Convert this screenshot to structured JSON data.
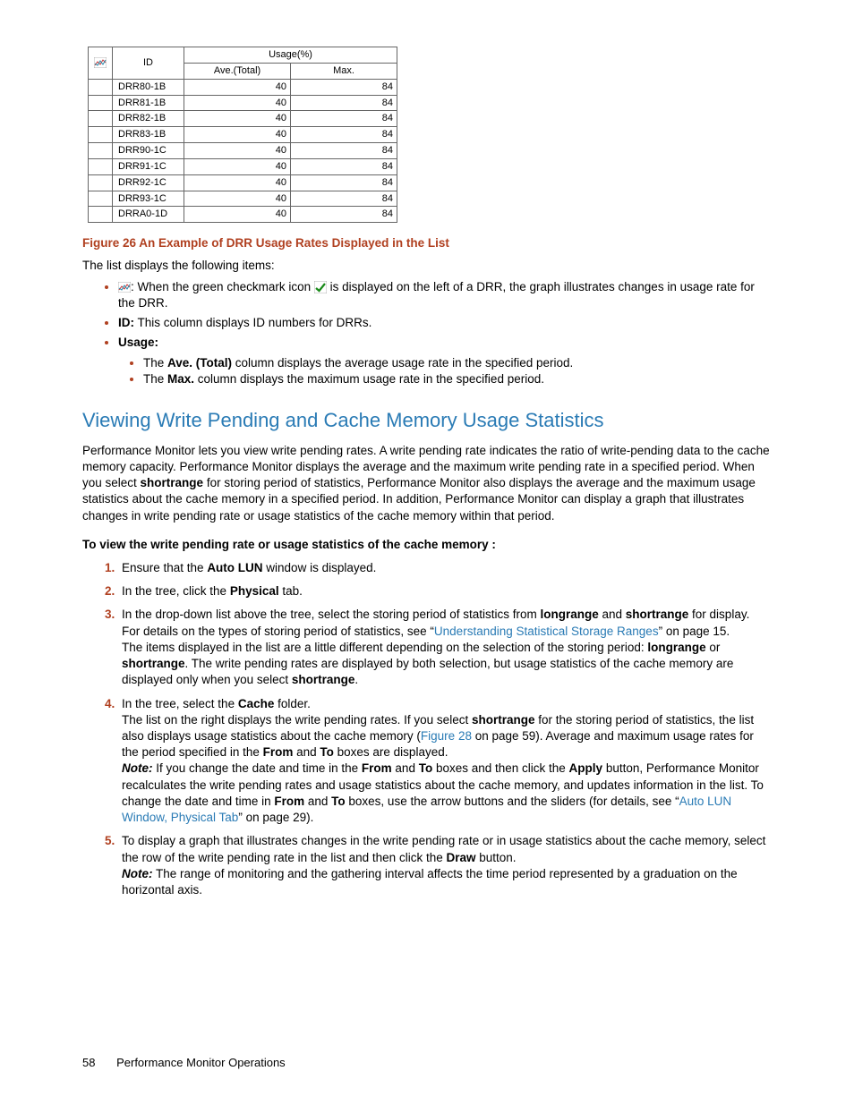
{
  "table": {
    "headers": {
      "id": "ID",
      "usage": "Usage(%)",
      "ave": "Ave.(Total)",
      "max": "Max."
    },
    "rows": [
      {
        "id": "DRR80-1B",
        "ave": "40",
        "max": "84"
      },
      {
        "id": "DRR81-1B",
        "ave": "40",
        "max": "84"
      },
      {
        "id": "DRR82-1B",
        "ave": "40",
        "max": "84"
      },
      {
        "id": "DRR83-1B",
        "ave": "40",
        "max": "84"
      },
      {
        "id": "DRR90-1C",
        "ave": "40",
        "max": "84"
      },
      {
        "id": "DRR91-1C",
        "ave": "40",
        "max": "84"
      },
      {
        "id": "DRR92-1C",
        "ave": "40",
        "max": "84"
      },
      {
        "id": "DRR93-1C",
        "ave": "40",
        "max": "84"
      },
      {
        "id": "DRRA0-1D",
        "ave": "40",
        "max": "84"
      }
    ]
  },
  "figure_caption": "Figure 26 An Example of DRR Usage Rates Displayed in the List",
  "intro_list": "The list displays the following items:",
  "bullets": {
    "b1_after": ": When the green checkmark icon ",
    "b1_end": " is displayed on the left of a DRR, the graph illustrates changes in usage rate for the DRR.",
    "b2_bold": "ID:",
    "b2_text": " This column displays ID numbers for DRRs.",
    "b3_bold": "Usage:",
    "b3_sub1_pre": "The ",
    "b3_sub1_bold": "Ave. (Total)",
    "b3_sub1_post": " column displays the average usage rate in the specified period.",
    "b3_sub2_pre": "The ",
    "b3_sub2_bold": "Max.",
    "b3_sub2_post": " column displays the maximum usage rate in the specified period."
  },
  "section_heading": "Viewing Write Pending and Cache Memory Usage Statistics",
  "section_para": "Performance Monitor lets you view write pending rates. A write pending rate indicates the ratio of write-pending data to the cache memory capacity. Performance Monitor displays the average and the maximum write pending rate in a specified period. When you select ",
  "section_para_b1": "shortrange",
  "section_para_2": " for storing period of statistics, Performance Monitor also displays the average and the maximum usage statistics about the cache memory in a specified period. In addition, Performance Monitor can display a graph that illustrates changes in write pending rate or usage statistics of the cache memory within that period.",
  "procedure_heading": "To view the write pending rate or usage statistics of the cache memory :",
  "step1_pre": "Ensure that the ",
  "step1_b": "Auto LUN",
  "step1_post": " window is displayed.",
  "step2_pre": "In the tree, click the ",
  "step2_b": "Physical",
  "step2_post": " tab.",
  "step3_pre": "In the drop-down list above the tree, select the storing period of statistics from ",
  "step3_b1": "longrange",
  "step3_mid": " and ",
  "step3_b2": "shortrange",
  "step3_post": " for display.",
  "step3_p2_pre": "For details on the types of storing period of statistics, see “",
  "step3_link": "Understanding Statistical Storage Ranges",
  "step3_p2_post": "” on page 15.",
  "step3_p3_pre": "The items displayed in the list are a little different depending on the selection of the storing period: ",
  "step3_p3_b1": "longrange",
  "step3_p3_mid": " or ",
  "step3_p3_b2": "shortrange",
  "step3_p3_post": ". The write pending rates are displayed by both selection, but usage statistics of the cache memory are displayed only when you select ",
  "step3_p3_b3": "shortrange",
  "step3_p3_end": ".",
  "step4_pre": "In the tree, select the ",
  "step4_b": "Cache",
  "step4_post": " folder.",
  "step4_p2_pre": "The list on the right displays the write pending rates. If you select ",
  "step4_p2_b1": "shortrange",
  "step4_p2_mid": " for the storing period of statistics, the list also displays usage statistics about the cache memory (",
  "step4_p2_link": "Figure 28",
  "step4_p2_post": " on page 59). Average and maximum usage rates for the period specified in the ",
  "step4_p2_b2": "From",
  "step4_p2_and": " and ",
  "step4_p2_b3": "To",
  "step4_p2_end": " boxes are displayed.",
  "step4_note": "Note:",
  "step4_p3_pre": " If you change the date and time in the ",
  "step4_p3_b1": "From",
  "step4_p3_and1": " and ",
  "step4_p3_b2": "To",
  "step4_p3_mid1": " boxes and then click the ",
  "step4_p3_b3": "Apply",
  "step4_p3_mid2": " button, Performance Monitor recalculates the write pending rates and usage statistics about the cache memory, and updates information in the list. To change the date and time in ",
  "step4_p3_b4": "From",
  "step4_p3_and2": " and ",
  "step4_p3_b5": "To",
  "step4_p3_mid3": " boxes, use the arrow buttons and the sliders (for details, see “",
  "step4_p3_link": "Auto LUN Window, Physical Tab",
  "step4_p3_post": "” on page 29).",
  "step5_pre": "To display a graph that illustrates changes in the write pending rate or in usage statistics about the cache memory, select the row of the write pending rate in the list and then click the ",
  "step5_b": "Draw",
  "step5_post": " button.",
  "step5_note": "Note:",
  "step5_p2": " The range of monitoring and the gathering interval affects the time period represented by a graduation on the horizontal axis.",
  "footer": {
    "page": "58",
    "title": "Performance Monitor Operations"
  }
}
